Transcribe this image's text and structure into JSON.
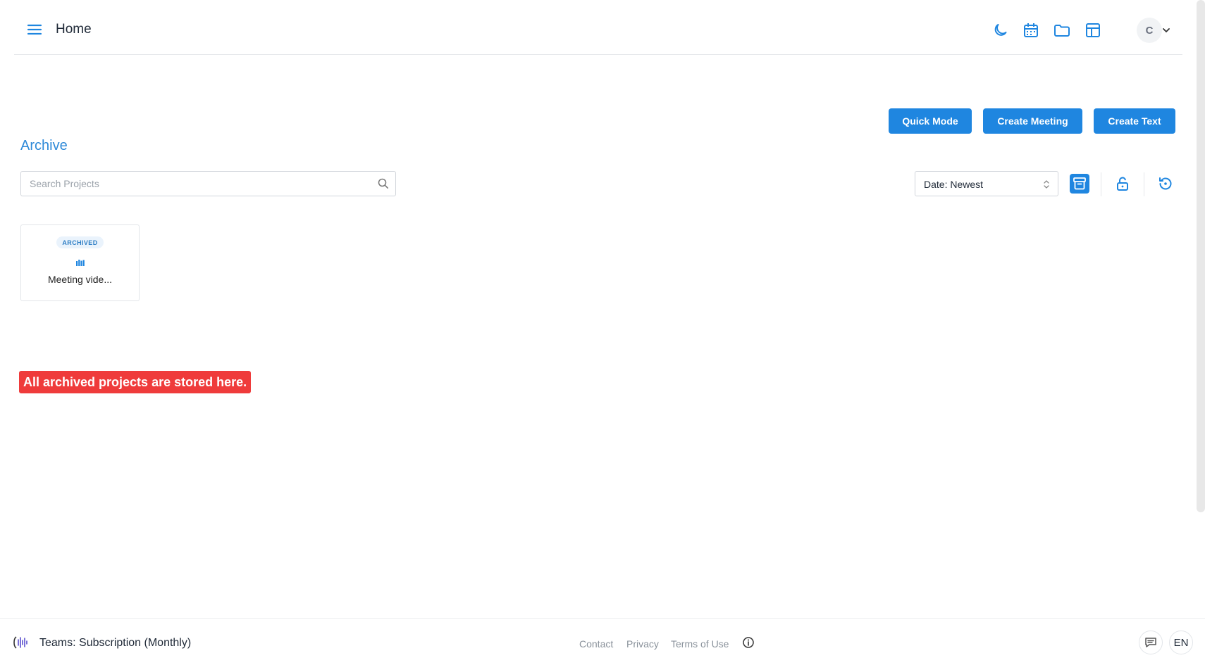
{
  "header": {
    "title": "Home",
    "avatar_initial": "C",
    "icons": [
      "menu-icon",
      "moon-icon",
      "calendar-icon",
      "folder-icon",
      "grid-layout-icon",
      "chevron-down-icon"
    ]
  },
  "actions": {
    "quick_mode": "Quick Mode",
    "create_meeting": "Create Meeting",
    "create_text": "Create Text"
  },
  "archive": {
    "title": "Archive",
    "search_placeholder": "Search Projects",
    "sort_value": "Date: Newest"
  },
  "projects": [
    {
      "badge": "ARCHIVED",
      "title": "Meeting vide..."
    }
  ],
  "caption": "All archived projects are stored here.",
  "footer": {
    "plan": "Teams: Subscription (Monthly)",
    "links": [
      "Contact",
      "Privacy",
      "Terms of Use"
    ],
    "language": "EN"
  },
  "colors": {
    "accent": "#1f86e0",
    "caption_bg": "#ef3b3b"
  }
}
